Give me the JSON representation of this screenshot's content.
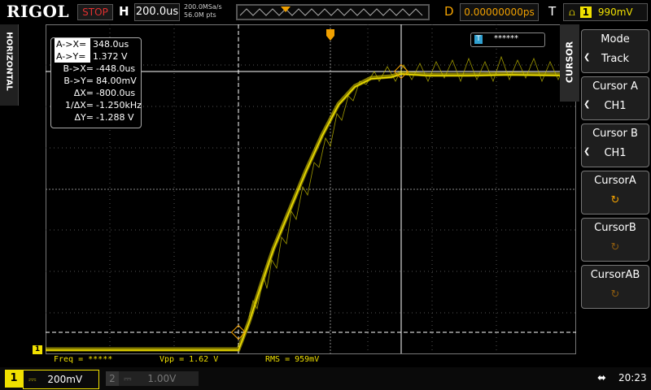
{
  "brand": "RIGOL",
  "top": {
    "run_status": "STOP",
    "h_label": "H",
    "timebase": "200.0us",
    "sample_rate": "200.0MSa/s",
    "mem_depth": "56.0M pts",
    "d_label": "D",
    "delay": "0.00000000ps",
    "t_label": "T",
    "trigger_level": "990mV",
    "trigger_channel": "1"
  },
  "side_tab": "HORIZONTAL",
  "cursor_readout": {
    "ax_key": "A->X=",
    "ax_val": "348.0us",
    "ay_key": "A->Y=",
    "ay_val": "1.372 V",
    "bx_key": "B->X=",
    "bx_val": "-448.0us",
    "by_key": "B->Y=",
    "by_val": "84.00mV",
    "dx_key": "ΔX=",
    "dx_val": "-800.0us",
    "inv_dx_key": "1/ΔX=",
    "inv_dx_val": "-1.250kHz",
    "dy_key": "ΔY=",
    "dy_val": "-1.288 V"
  },
  "trace_badge": {
    "icon": "T",
    "text": "******"
  },
  "measurements": {
    "freq": "Freq = *****",
    "vpp": "Vpp = 1.62 V",
    "rms": "RMS = 959mV"
  },
  "menu": {
    "tab_title": "CURSOR",
    "items": [
      {
        "label": "Mode",
        "value": "Track"
      },
      {
        "label": "Cursor A",
        "value": "CH1"
      },
      {
        "label": "Cursor B",
        "value": "CH1"
      },
      {
        "label": "CursorA",
        "value": ""
      },
      {
        "label": "CursorB",
        "value": ""
      },
      {
        "label": "CursorAB",
        "value": ""
      }
    ]
  },
  "bottom": {
    "ch1_num": "1",
    "ch1_scale": "200mV",
    "ch2_num": "2",
    "ch2_scale": "1.00V",
    "clock": "20:23"
  },
  "channel_marker": "1",
  "colors": {
    "ch1": "#f0e000",
    "accent": "#f0a000",
    "stop": "#e03030"
  }
}
